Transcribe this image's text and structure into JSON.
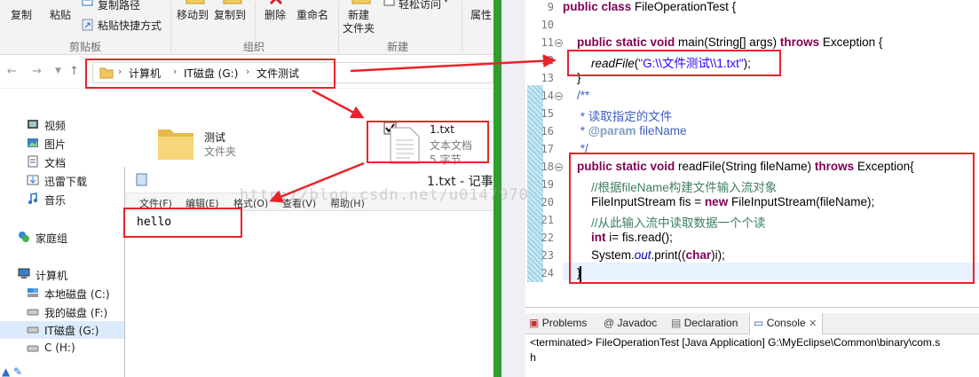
{
  "ribbon": {
    "copy": "复制",
    "paste": "粘贴",
    "copy_path": "复制路径",
    "paste_shortcut": "粘贴快捷方式",
    "move_to": "移动到",
    "copy_to": "复制到",
    "delete": "删除",
    "rename": "重命名",
    "new_folder": "新建\n文件夹",
    "new_folder_line1": "新建",
    "new_folder_line2": "文件夹",
    "easy_access": "轻松访问",
    "properties": "属性",
    "group_clipboard": "剪贴板",
    "group_organize": "组织",
    "group_new": "新建"
  },
  "address": {
    "crumbs": [
      "计算机",
      "IT磁盘 (G:)",
      "文件测试"
    ]
  },
  "nav": {
    "items": [
      "视频",
      "图片",
      "文档",
      "迅雷下载",
      "音乐",
      "家庭组",
      "计算机",
      "本地磁盘 (C:)",
      "我的磁盘 (F:)",
      "IT磁盘 (G:)",
      "C (H:)"
    ]
  },
  "files": [
    {
      "name": "测试",
      "type": "文件夹"
    },
    {
      "name": "1.txt",
      "type": "文本文档",
      "size": "5 字节"
    }
  ],
  "notepad": {
    "title": "1.txt - 记事",
    "menu": [
      "文件(F)",
      "编辑(E)",
      "格式(O)",
      "查看(V)",
      "帮助(H)"
    ],
    "content": "hello"
  },
  "watermark": "http://blog.csdn.net/u0147970",
  "editor": {
    "lines": [
      "9",
      "10",
      "11",
      "12",
      "13",
      "14",
      "15",
      "16",
      "17",
      "18",
      "19",
      "20",
      "21",
      "22",
      "23",
      "24"
    ],
    "code": {
      "l9_kw": "public class ",
      "l9_rest": "FileOperationTest {",
      "l11_kw1": "public static void ",
      "l11_mid": "main(String[] args) ",
      "l11_kw2": "throws ",
      "l11_end": "Exception {",
      "l12_call": "readFile",
      "l12_open": "(",
      "l12_str": "\"G:\\\\文件测试\\\\1.txt\"",
      "l12_close": ");",
      "l13": "}",
      "l14": "/**",
      "l15": " * 读取指定的文件",
      "l16_star": " * ",
      "l16_tag": "@param",
      "l16_name": " fileName",
      "l17": " */",
      "l18_kw1": "public static void ",
      "l18_mid": "readFile(String fileName) ",
      "l18_kw2": "throws ",
      "l18_end": "Exception{",
      "l19": "//根据fileName构建文件输入流对象",
      "l20_a": "FileInputStream fis = ",
      "l20_kw": "new ",
      "l20_b": "FileInputStream(fileName);",
      "l21": "//从此输入流中读取数据一个个读",
      "l22_kw": "int ",
      "l22_rest": "i= fis.read();",
      "l23_a": "System.",
      "l23_out": "out",
      "l23_b": ".print((",
      "l23_kw": "char",
      "l23_c": ")i);",
      "l24": "}"
    }
  },
  "console": {
    "tabs": [
      "Problems",
      "Javadoc",
      "Declaration",
      "Console"
    ],
    "info": "<terminated> FileOperationTest [Java Application] G:\\MyEclipse\\Common\\binary\\com.s",
    "output": "h"
  },
  "colors": {
    "annotation_red": "#e8232a",
    "divider_green": "#2f9d2e",
    "keyword": "#7f0055",
    "string": "#2a00ff",
    "comment": "#3f7f5f",
    "javadoc": "#3f5fbf"
  }
}
